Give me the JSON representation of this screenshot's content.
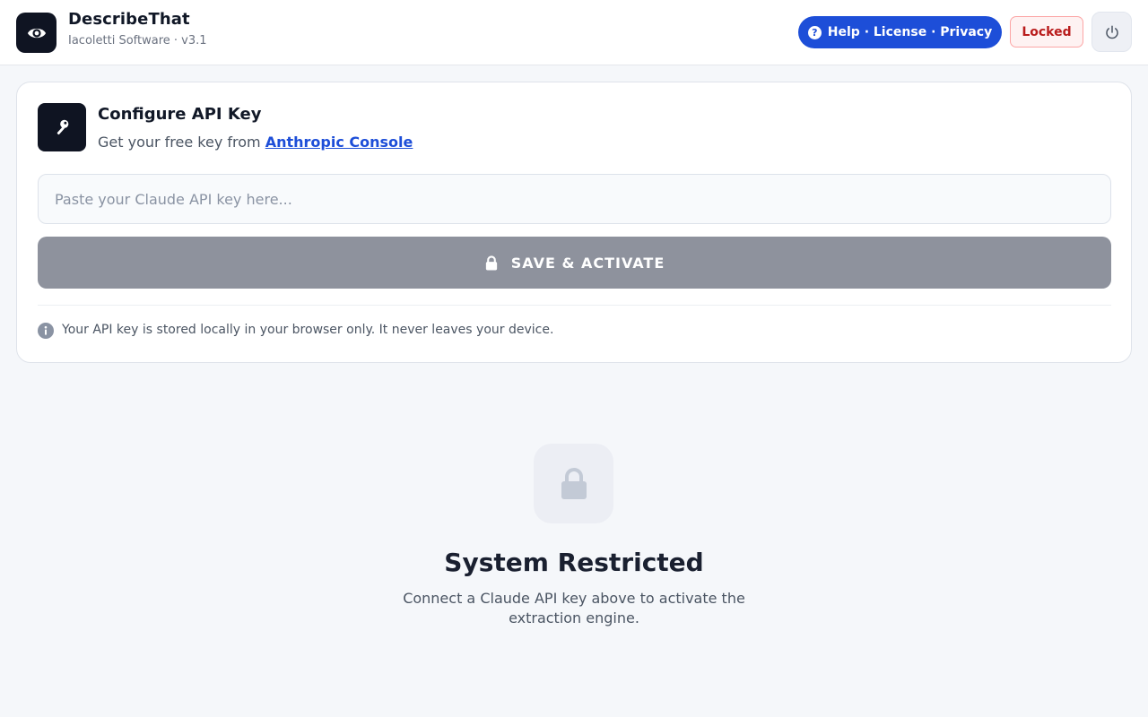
{
  "header": {
    "app_name": "DescribeThat",
    "app_subtitle": "Iacoletti Software · v3.1",
    "logo_icon": "eye-icon",
    "help_links_label": "Help · License · Privacy",
    "status_badge": "Locked",
    "power_icon": "power-icon"
  },
  "api_card": {
    "title": "Configure API Key",
    "subtitle_prefix": "Get your free key from ",
    "console_link": "Anthropic Console",
    "input_placeholder": "Paste your Claude API key here...",
    "input_value": "",
    "save_button_label": "SAVE & ACTIVATE",
    "info_text": "Your API key is stored locally in your browser only. It never leaves your device."
  },
  "restricted": {
    "title": "System Restricted",
    "description": "Connect a Claude API key above to activate the extraction engine."
  },
  "colors": {
    "brand_dark": "#0f1422",
    "accent_blue": "#1d4ed8",
    "locked_red": "#b91c1c",
    "disabled_button": "#8e929d"
  }
}
